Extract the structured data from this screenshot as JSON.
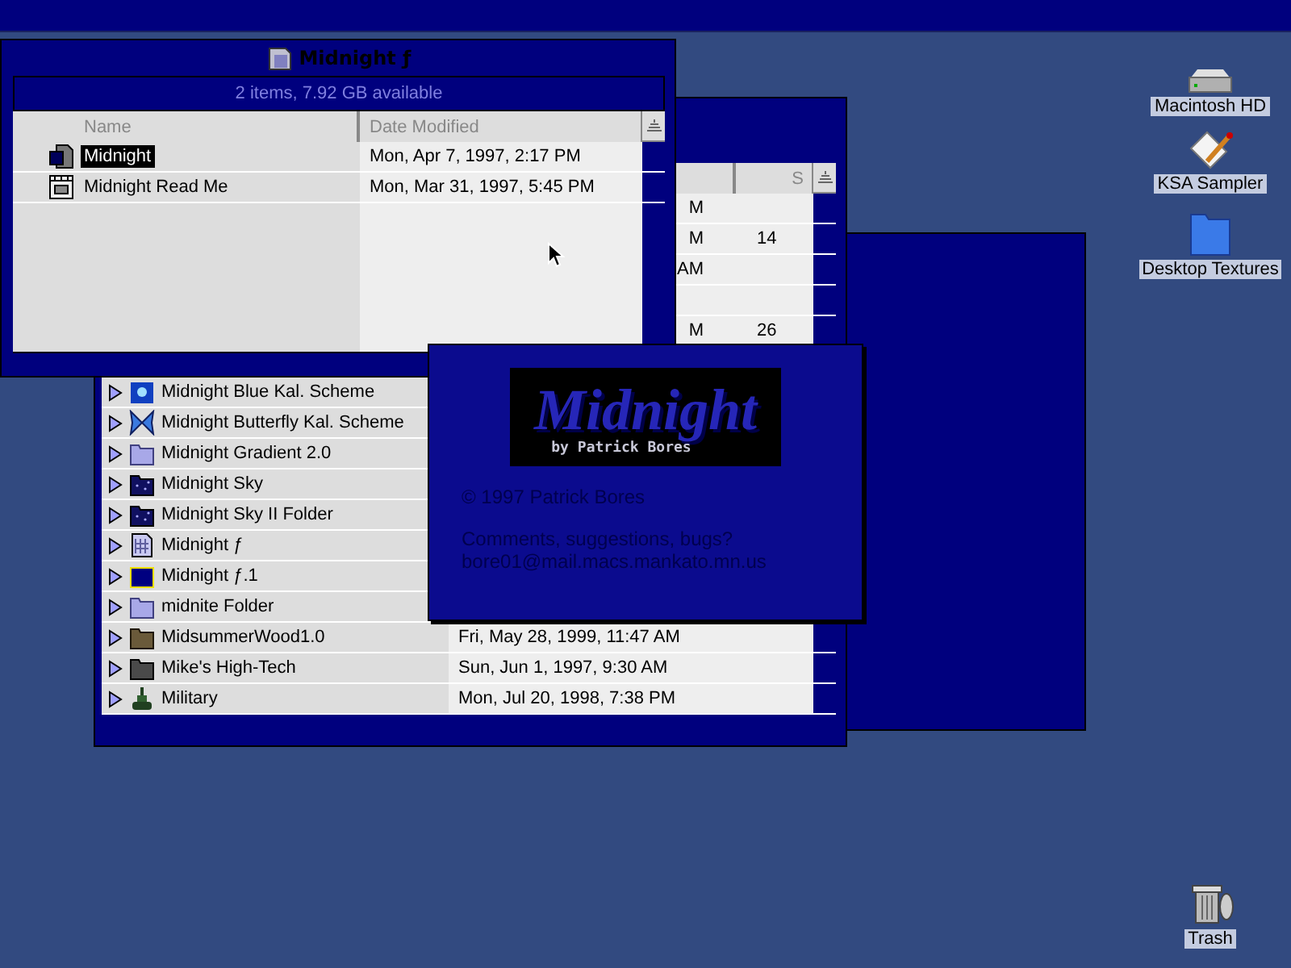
{
  "back_window": {
    "column_3_header": "S",
    "rows": [
      {
        "kind": "partial",
        "column_2": "M"
      },
      {
        "kind": "partial",
        "column_2": "M",
        "column_3": "14"
      },
      {
        "kind": "partial",
        "column_2": "AM"
      },
      {
        "kind": "partial"
      },
      {
        "kind": "partial",
        "column_2": "M",
        "column_3": "26"
      },
      {
        "kind": "sphere",
        "name": "Midnight Blue Kal. Scheme",
        "expanded": false
      },
      {
        "kind": "butterfly",
        "name": "Midnight Butterfly Kal. Scheme",
        "expanded": false
      },
      {
        "kind": "folder",
        "name": "Midnight Gradient 2.0",
        "expanded": false
      },
      {
        "kind": "stars",
        "name": "Midnight Sky",
        "expanded": false
      },
      {
        "kind": "stars",
        "name": "Midnight Sky II Folder",
        "expanded": false
      },
      {
        "kind": "pattern",
        "name": "Midnight ƒ",
        "expanded": false
      },
      {
        "kind": "gradient",
        "name": "Midnight ƒ.1",
        "expanded": false
      },
      {
        "kind": "folder",
        "name": "midnite Folder",
        "expanded": false
      },
      {
        "kind": "wood",
        "name": "MidsummerWood1.0",
        "date": "Fri, May 28, 1999, 11:47 AM",
        "expanded": false
      },
      {
        "kind": "dark",
        "name": "Mike's High-Tech",
        "date": "Sun, Jun 1, 1997, 9:30 AM",
        "expanded": false
      },
      {
        "kind": "tank",
        "name": "Military",
        "date": "Mon, Jul 20, 1998, 7:38 PM",
        "expanded": false
      }
    ]
  },
  "front_window": {
    "title": "Midnight ƒ",
    "info": "2 items, 7.92 GB available",
    "columns": [
      "Name",
      "Date Modified"
    ],
    "rows": [
      {
        "kind": "application",
        "name": "Midnight",
        "date": "Mon, Apr 7, 1997, 2:17 PM",
        "selected": true
      },
      {
        "kind": "readme",
        "name": "Midnight Read Me",
        "date": "Mon, Mar 31, 1997, 5:45 PM",
        "selected": false
      }
    ]
  },
  "about_window": {
    "logo_title": "Midnight",
    "logo_byline": "by Patrick Bores",
    "copyright": "© 1997 Patrick Bores",
    "lines": [
      "Comments, suggestions, bugs?",
      "bore01@mail.macs.mankato.mn.us"
    ]
  },
  "desktop_icons": [
    {
      "kind": "disk",
      "label": "Macintosh HD"
    },
    {
      "kind": "app",
      "label": "KSA Sampler"
    },
    {
      "kind": "folder",
      "label": "Desktop Textures"
    },
    {
      "kind": "trash",
      "label": "Trash"
    }
  ]
}
